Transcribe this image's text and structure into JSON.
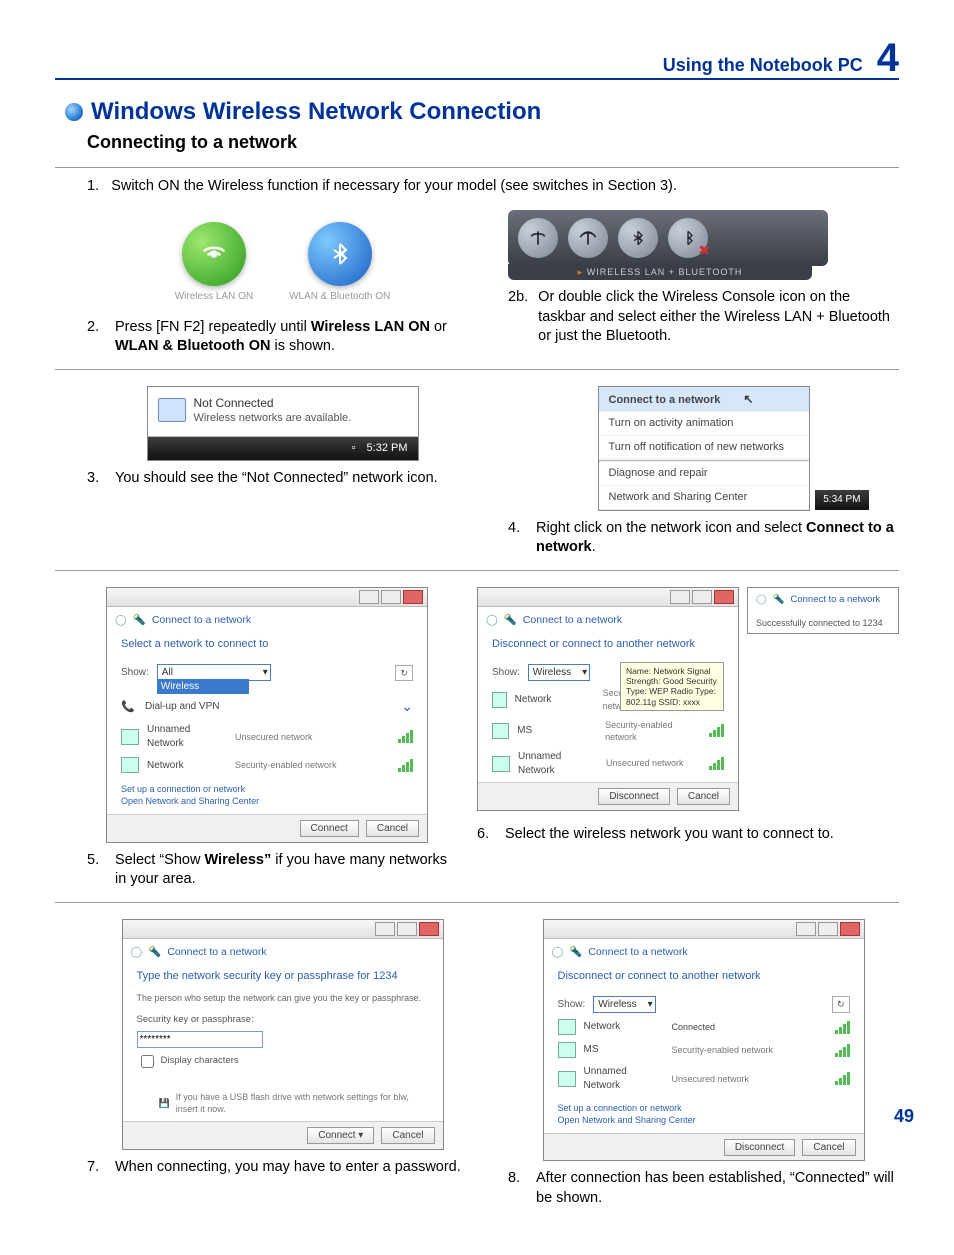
{
  "header": {
    "title": "Using the Notebook PC",
    "chapter": "4"
  },
  "section": {
    "title": "Windows Wireless Network Connection",
    "subtitle": "Connecting to a network"
  },
  "steps": {
    "s1": "Switch ON the Wireless function if necessary for your model (see switches in Section 3).",
    "s2_pre": "Press [FN F2] repeatedly until ",
    "s2_b1": "Wireless LAN ON",
    "s2_mid": " or ",
    "s2_b2": "WLAN & Bluetooth ON",
    "s2_post": " is shown.",
    "s2b": "Or double click the Wireless Console icon on the taskbar and select either the Wireless LAN + Bluetooth or just the Bluetooth.",
    "s3": "You should see the “Not Connected” network icon.",
    "s4_pre": "Right click on the network icon and select ",
    "s4_b": "Connect to a network",
    "s4_post": ".",
    "s5_pre": "Select “Show ",
    "s5_b": "Wireless”",
    "s5_post": " if you have many networks in your area.",
    "s6": "Select the wireless network you want to connect to.",
    "s7": "When connecting, you may have to enter a password.",
    "s8": "After connection has been established, “Connected” will be shown."
  },
  "labels": {
    "n1": "1.",
    "n2": "2.",
    "n2b": "2b.",
    "n3": "3.",
    "n4": "4.",
    "n5": "5.",
    "n6": "6.",
    "n7": "7.",
    "n8": "8."
  },
  "icons": {
    "wlan_on": "Wireless LAN ON",
    "wlan_bt_on": "WLAN & Bluetooth ON"
  },
  "console": {
    "caption": "WIRELESS LAN + BLUETOOTH"
  },
  "tray": {
    "not_connected": "Not Connected",
    "avail": "Wireless networks are available.",
    "time1": "5:32 PM",
    "time2": "5:34 PM"
  },
  "ctx": {
    "i1": "Connect to a network",
    "i2": "Turn on activity animation",
    "i3": "Turn off notification of new networks",
    "i4": "Diagnose and repair",
    "i5": "Network and Sharing Center"
  },
  "dlg": {
    "crumb": "Connect to a network",
    "select_prompt": "Select a network to connect to",
    "disconnect_prompt": "Disconnect or connect to another network",
    "show": "Show:",
    "show_all": "All",
    "show_wireless": "Wireless",
    "dialup": "Dial-up and VPN",
    "net1": "Network",
    "net1d": "Security-enabled network",
    "net2": "Unnamed Network",
    "net2d": "Unsecured network",
    "net3": "Network",
    "net3d": "Security-enabled network",
    "net_ms": "MS",
    "net_msd": "Security-enabled network",
    "connected_status": "Connected",
    "tooltip": "Name: Network\nSignal Strength: Good\nSecurity Type: WEP\nRadio Type: 802.11g\nSSID: xxxx",
    "link1": "Set up a connection or network",
    "link2": "Open Network and Sharing Center",
    "btn_connect": "Connect",
    "btn_cancel": "Cancel",
    "btn_disconnect": "Disconnect",
    "pw_prompt": "Type the network security key or passphrase for 1234",
    "pw_sub": "The person who setup the network can give you the key or passphrase.",
    "pw_label": "Security key or passphrase:",
    "pw_value": "********",
    "pw_chk": "Display characters",
    "pw_hint": "If you have a USB flash drive with network settings for blw, insert it now.",
    "success": "Successfully connected to 1234"
  },
  "page_number": "49"
}
